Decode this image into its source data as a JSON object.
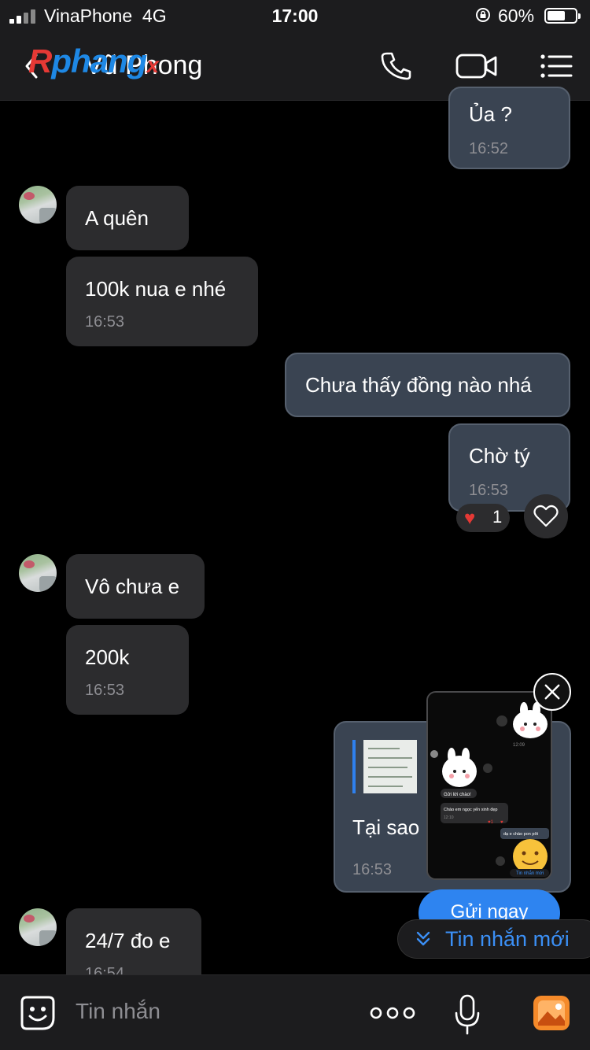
{
  "status_bar": {
    "carrier": "VinaPhone",
    "network": "4G",
    "time": "17:00",
    "battery": "60%"
  },
  "header": {
    "contact_name": "Vũ Phong",
    "watermark": "Rphangx"
  },
  "messages": [
    {
      "side": "out",
      "text": "Ủa ?",
      "time": "16:52"
    },
    {
      "side": "in",
      "text": "A quên"
    },
    {
      "side": "in",
      "text": "100k nua e nhé",
      "time": "16:53"
    },
    {
      "side": "out",
      "text": "Chưa thấy đồng nào nhá"
    },
    {
      "side": "out",
      "text": "Chờ tý",
      "time": "16:53",
      "reaction": {
        "emoji": "heart",
        "count": "1"
      }
    },
    {
      "side": "in",
      "text": "Vô chưa e"
    },
    {
      "side": "in",
      "text": "200k",
      "time": "16:53"
    },
    {
      "side": "out",
      "text": "Tại sao",
      "time": "16:53",
      "has_attachment": true
    },
    {
      "side": "in",
      "text": "24/7 đo e",
      "time": "16:54"
    }
  ],
  "preview_popup": {
    "time1": "12:09",
    "greet_button": "Gửi lời chào!",
    "bubble_in": "Chào em ngọc yến xinh đẹp",
    "bubble_in_time": "12:10",
    "bubble_out": "dạ e chào pon pôt",
    "new_msg": "Tin nhắn mới"
  },
  "send_now": "Gửi ngay",
  "new_messages": "Tin nhắn mới",
  "composer": {
    "placeholder": "Tin nhắn"
  },
  "colors": {
    "accent": "#2e84f0",
    "bubble_in": "#2c2c2e",
    "bubble_out": "#3a4452"
  }
}
